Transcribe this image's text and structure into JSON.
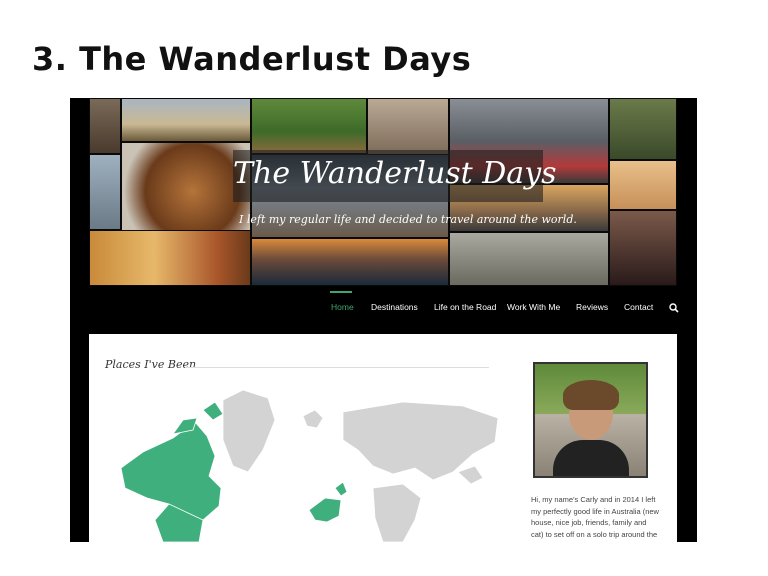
{
  "slide": {
    "title": "3. The Wanderlust Days"
  },
  "site": {
    "title": "The Wanderlust Days",
    "tagline": "I left my regular life and decided to travel around the world."
  },
  "nav": {
    "items": [
      {
        "label": "Home",
        "active": true
      },
      {
        "label": "Destinations"
      },
      {
        "label": "Life on the Road"
      },
      {
        "label": "Work With Me"
      },
      {
        "label": "Reviews"
      },
      {
        "label": "Contact"
      }
    ],
    "search_icon": "search-icon"
  },
  "main": {
    "section_title": "Places I've Been",
    "map_visited_color": "#3fb07d",
    "map_other_color": "#d3d3d3"
  },
  "sidebar": {
    "bio": "Hi, my name's Carly and in 2014 I left my perfectly good life in Australia (new house, nice job, friends, family and cat) to set off on a solo trip around the world."
  },
  "colors": {
    "accent": "#41a570",
    "header_bg": "#000000"
  }
}
